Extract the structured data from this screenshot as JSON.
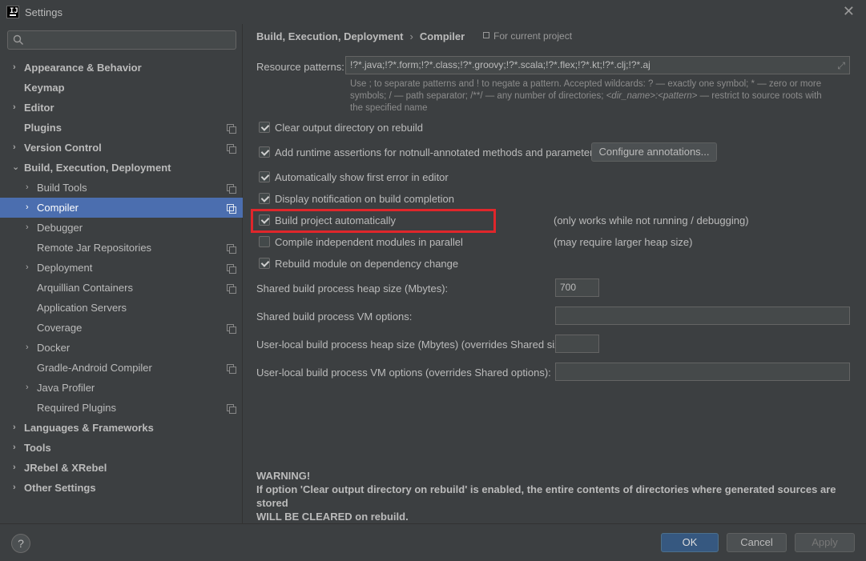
{
  "window": {
    "title": "Settings",
    "app_icon_letters": "IJ"
  },
  "search": {
    "placeholder": "",
    "value": ""
  },
  "sidebar": {
    "items": [
      {
        "label": "Appearance & Behavior",
        "arrow": "›",
        "bold": true
      },
      {
        "label": "Keymap",
        "arrow": "",
        "bold": true
      },
      {
        "label": "Editor",
        "arrow": "›",
        "bold": true
      },
      {
        "label": "Plugins",
        "arrow": "",
        "bold": true
      },
      {
        "label": "Version Control",
        "arrow": "›",
        "bold": true
      },
      {
        "label": "Build, Execution, Deployment",
        "arrow": "⌄",
        "bold": true
      },
      {
        "label": "Build Tools",
        "arrow": "›"
      },
      {
        "label": "Compiler",
        "arrow": "›",
        "selected": true
      },
      {
        "label": "Debugger",
        "arrow": "›"
      },
      {
        "label": "Remote Jar Repositories",
        "arrow": ""
      },
      {
        "label": "Deployment",
        "arrow": "›"
      },
      {
        "label": "Arquillian Containers",
        "arrow": ""
      },
      {
        "label": "Application Servers",
        "arrow": ""
      },
      {
        "label": "Coverage",
        "arrow": ""
      },
      {
        "label": "Docker",
        "arrow": "›"
      },
      {
        "label": "Gradle-Android Compiler",
        "arrow": ""
      },
      {
        "label": "Java Profiler",
        "arrow": "›"
      },
      {
        "label": "Required Plugins",
        "arrow": ""
      },
      {
        "label": "Languages & Frameworks",
        "arrow": "›",
        "bold": true
      },
      {
        "label": "Tools",
        "arrow": "›",
        "bold": true
      },
      {
        "label": "JRebel & XRebel",
        "arrow": "›",
        "bold": true
      },
      {
        "label": "Other Settings",
        "arrow": "›",
        "bold": true
      }
    ]
  },
  "breadcrumb": {
    "part1": "Build, Execution, Deployment",
    "separator": "›",
    "part2": "Compiler"
  },
  "scope_note": "For current project",
  "resource_patterns": {
    "label": "Resource patterns:",
    "value": "!?*.java;!?*.form;!?*.class;!?*.groovy;!?*.scala;!?*.flex;!?*.kt;!?*.clj;!?*.aj",
    "hint_line1": "Use ; to separate patterns and ! to negate a pattern. Accepted wildcards: ? — exactly one symbol; * — zero or more",
    "hint_line2a": "symbols; / — path separator; /**/ — any number of directories; ",
    "hint_line2b": "<dir_name>:<pattern>",
    "hint_line2c": " — restrict to source roots with",
    "hint_line3": "the specified name"
  },
  "checkboxes": {
    "clear_output": {
      "label": "Clear output directory on rebuild",
      "checked": true
    },
    "runtime_assertions": {
      "label": "Add runtime assertions for notnull-annotated methods and parameters",
      "checked": true
    },
    "show_first_error": {
      "label": "Automatically show first error in editor",
      "checked": true
    },
    "display_notification": {
      "label": "Display notification on build completion",
      "checked": true
    },
    "build_automatically": {
      "label": "Build project automatically",
      "checked": true,
      "note": "(only works while not running / debugging)"
    },
    "compile_parallel": {
      "label": "Compile independent modules in parallel",
      "checked": false,
      "note": "(may require larger heap size)"
    },
    "rebuild_on_dependency": {
      "label": "Rebuild module on dependency change",
      "checked": true
    }
  },
  "configure_annotations_label": "Configure annotations...",
  "fields": {
    "shared_heap_label": "Shared build process heap size (Mbytes):",
    "shared_heap_value": "700",
    "shared_vm_label": "Shared build process VM options:",
    "shared_vm_value": "",
    "user_heap_label": "User-local build process heap size (Mbytes) (overrides Shared size):",
    "user_heap_value": "",
    "user_vm_label": "User-local build process VM options (overrides Shared options):",
    "user_vm_value": ""
  },
  "warning": {
    "title": "WARNING!",
    "line1": "If option 'Clear output directory on rebuild' is enabled, the entire contents of directories where generated sources are stored",
    "line2": "WILL BE CLEARED on rebuild."
  },
  "footer": {
    "help": "?",
    "ok": "OK",
    "cancel": "Cancel",
    "apply": "Apply"
  },
  "colors": {
    "background": "#3c3f41",
    "selection": "#4b6eaf",
    "highlight": "#e0262b",
    "ok_button": "#365880"
  }
}
